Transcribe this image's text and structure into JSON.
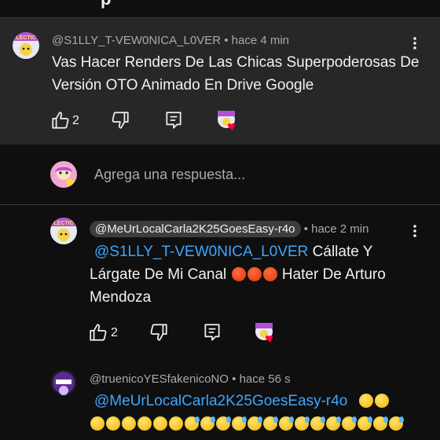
{
  "header": {
    "title": "p"
  },
  "comments": [
    {
      "author": "@S1LLY_T-VEW0NICA_L0VER",
      "time": "• hace 4 min",
      "text": "Vas Hacer Renders De Las Chicas Superpoderosas De Versión OTO Animado En Drive Google",
      "likes": "2"
    }
  ],
  "reply_box": {
    "placeholder": "Agrega una respuesta..."
  },
  "replies": [
    {
      "author": "@MeUrLocalCarla2K25GoesEasy-r4o",
      "time": "• hace 2 min",
      "mention": "@S1LLY_T-VEW0NICA_L0VER",
      "text_part1": "Cállate Y",
      "text_line2": "Lárgate De Mi Canal",
      "text_line2b": "Hater De Arturo",
      "text_line3": "Mendoza",
      "likes": "2"
    },
    {
      "author": "@truenicoYESfakenicoNO",
      "time": "• hace 56 s",
      "mention": "@MeUrLocalCarla2K25GoesEasy-r4o"
    }
  ],
  "icons": [
    "like-icon",
    "dislike-icon",
    "reply-icon",
    "more-icon",
    "heart-icon"
  ],
  "colors": {
    "background": "#0f0f0f",
    "highlight": "#272727",
    "mention": "#3ea6ff",
    "heart": "#ff0033"
  }
}
